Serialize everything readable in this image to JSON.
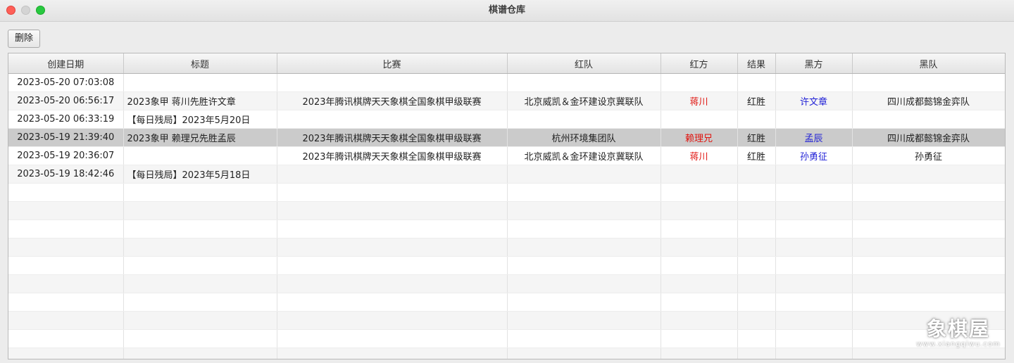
{
  "window": {
    "title": "棋谱仓库"
  },
  "toolbar": {
    "delete_label": "删除"
  },
  "table": {
    "columns": [
      "创建日期",
      "标题",
      "比赛",
      "红队",
      "红方",
      "结果",
      "黑方",
      "黑队"
    ],
    "rows": [
      [
        "2023-05-20 07:03:08",
        "",
        "",
        "",
        "",
        "",
        "",
        ""
      ],
      [
        "2023-05-20 06:56:17",
        "2023象甲 蒋川先胜许文章",
        "2023年腾讯棋牌天天象棋全国象棋甲级联赛",
        "北京威凯＆金环建设京冀联队",
        "蒋川",
        "红胜",
        "许文章",
        "四川成都懿锦金弈队"
      ],
      [
        "2023-05-20 06:33:19",
        "【每日残局】2023年5月20日",
        "",
        "",
        "",
        "",
        "",
        ""
      ],
      [
        "2023-05-19 21:39:40",
        "2023象甲 赖理兄先胜孟辰",
        "2023年腾讯棋牌天天象棋全国象棋甲级联赛",
        "杭州环境集团队",
        "赖理兄",
        "红胜",
        "孟辰",
        "四川成都懿锦金弈队"
      ],
      [
        "2023-05-19 20:36:07",
        "",
        "2023年腾讯棋牌天天象棋全国象棋甲级联赛",
        "北京威凯＆金环建设京冀联队",
        "蒋川",
        "红胜",
        "孙勇征",
        "孙勇征"
      ],
      [
        "2023-05-19 18:42:46",
        "【每日残局】2023年5月18日",
        "",
        "",
        "",
        "",
        "",
        ""
      ]
    ],
    "selected_row": 3,
    "empty_rows": 10
  },
  "colors": {
    "red_player": "#e0140f",
    "black_player": "#1f1fd6",
    "selected_bg": "#cbcbcb"
  },
  "watermark": {
    "main": "象棋屋",
    "sub": "www.xiangqiwu.com"
  }
}
